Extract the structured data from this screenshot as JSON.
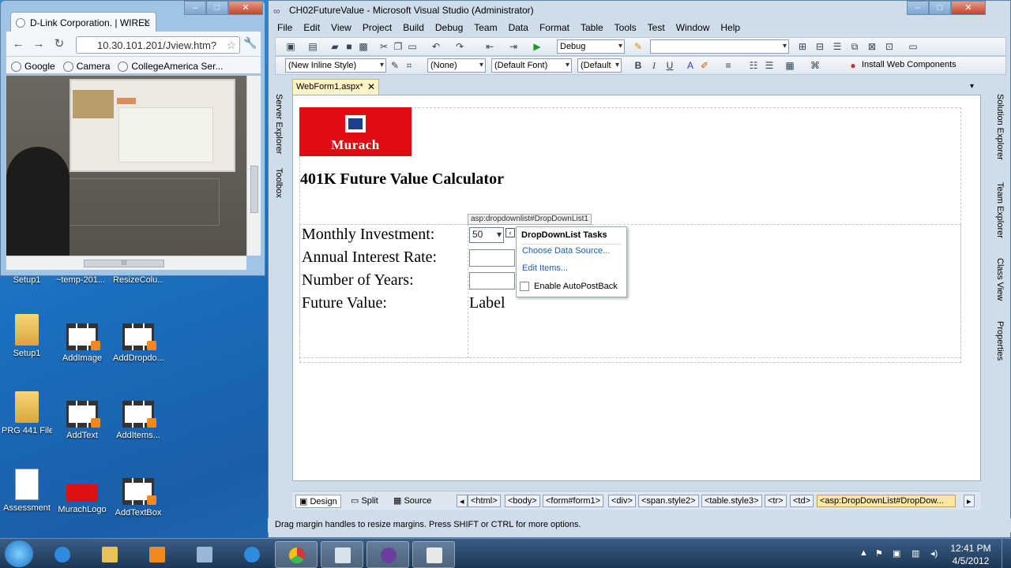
{
  "browser": {
    "tab_title": "D-Link Corporation. | WIREL",
    "url": "10.30.101.201/Jview.htm?",
    "bookmarks": [
      "Google",
      "Camera",
      "CollegeAmerica Ser..."
    ],
    "scroll_label": "III"
  },
  "desktop": {
    "partial_labels": [
      "Setup1",
      "~temp-201...",
      "ResizeColu..."
    ],
    "icons": [
      {
        "label": "Setup1",
        "icon": "folder-icon"
      },
      {
        "label": "AddImage",
        "icon": "video-file-icon"
      },
      {
        "label": "AddDropdo...",
        "icon": "video-file-icon"
      },
      {
        "label": "PRG 441 Files",
        "icon": "folder-icon"
      },
      {
        "label": "AddText",
        "icon": "video-file-icon"
      },
      {
        "label": "AddItems...",
        "icon": "video-file-icon"
      },
      {
        "label": "Assessment",
        "icon": "document-icon"
      },
      {
        "label": "MurachLogo",
        "icon": "image-icon"
      },
      {
        "label": "AddTextBox",
        "icon": "video-file-icon"
      }
    ]
  },
  "vs": {
    "title": "CH02FutureValue - Microsoft Visual Studio (Administrator)",
    "menu": [
      "File",
      "Edit",
      "View",
      "Project",
      "Build",
      "Debug",
      "Team",
      "Data",
      "Format",
      "Table",
      "Tools",
      "Test",
      "Window",
      "Help"
    ],
    "toolbar": {
      "config": "Debug",
      "style": "(New Inline Style)",
      "block": "(None)",
      "font": "(Default Font)",
      "size": "(Default",
      "bold": "B",
      "italic": "I",
      "underline": "U",
      "install": "Install Web Components"
    },
    "left_panels": [
      "Server Explorer",
      "Toolbox"
    ],
    "right_panels": [
      "Solution Explorer",
      "Team Explorer",
      "Class View",
      "Properties"
    ],
    "doc_tab": "WebForm1.aspx*",
    "logo_text": "Murach",
    "heading": "401K Future Value Calculator",
    "form": {
      "labels": [
        "Monthly Investment:",
        "Annual Interest Rate:",
        "Number of Years:",
        "Future Value:"
      ],
      "dropdown_value": "50",
      "result_label": "Label",
      "tooltip": "asp:dropdownlist#DropDownList1"
    },
    "tasks": {
      "title": "DropDownList Tasks",
      "choose": "Choose Data Source...",
      "edit": "Edit Items...",
      "autopostback": "Enable AutoPostBack"
    },
    "views": [
      "Design",
      "Split",
      "Source"
    ],
    "crumbs": [
      "<html>",
      "<body>",
      "<form#form1>",
      "<div>",
      "<span.style2>",
      "<table.style3>",
      "<tr>",
      "<td>",
      "<asp:DropDownList#DropDow..."
    ],
    "status": "Drag margin handles to resize margins. Press SHIFT or CTRL for more options."
  },
  "taskbar": {
    "time": "12:41 PM",
    "date": "4/5/2012"
  }
}
